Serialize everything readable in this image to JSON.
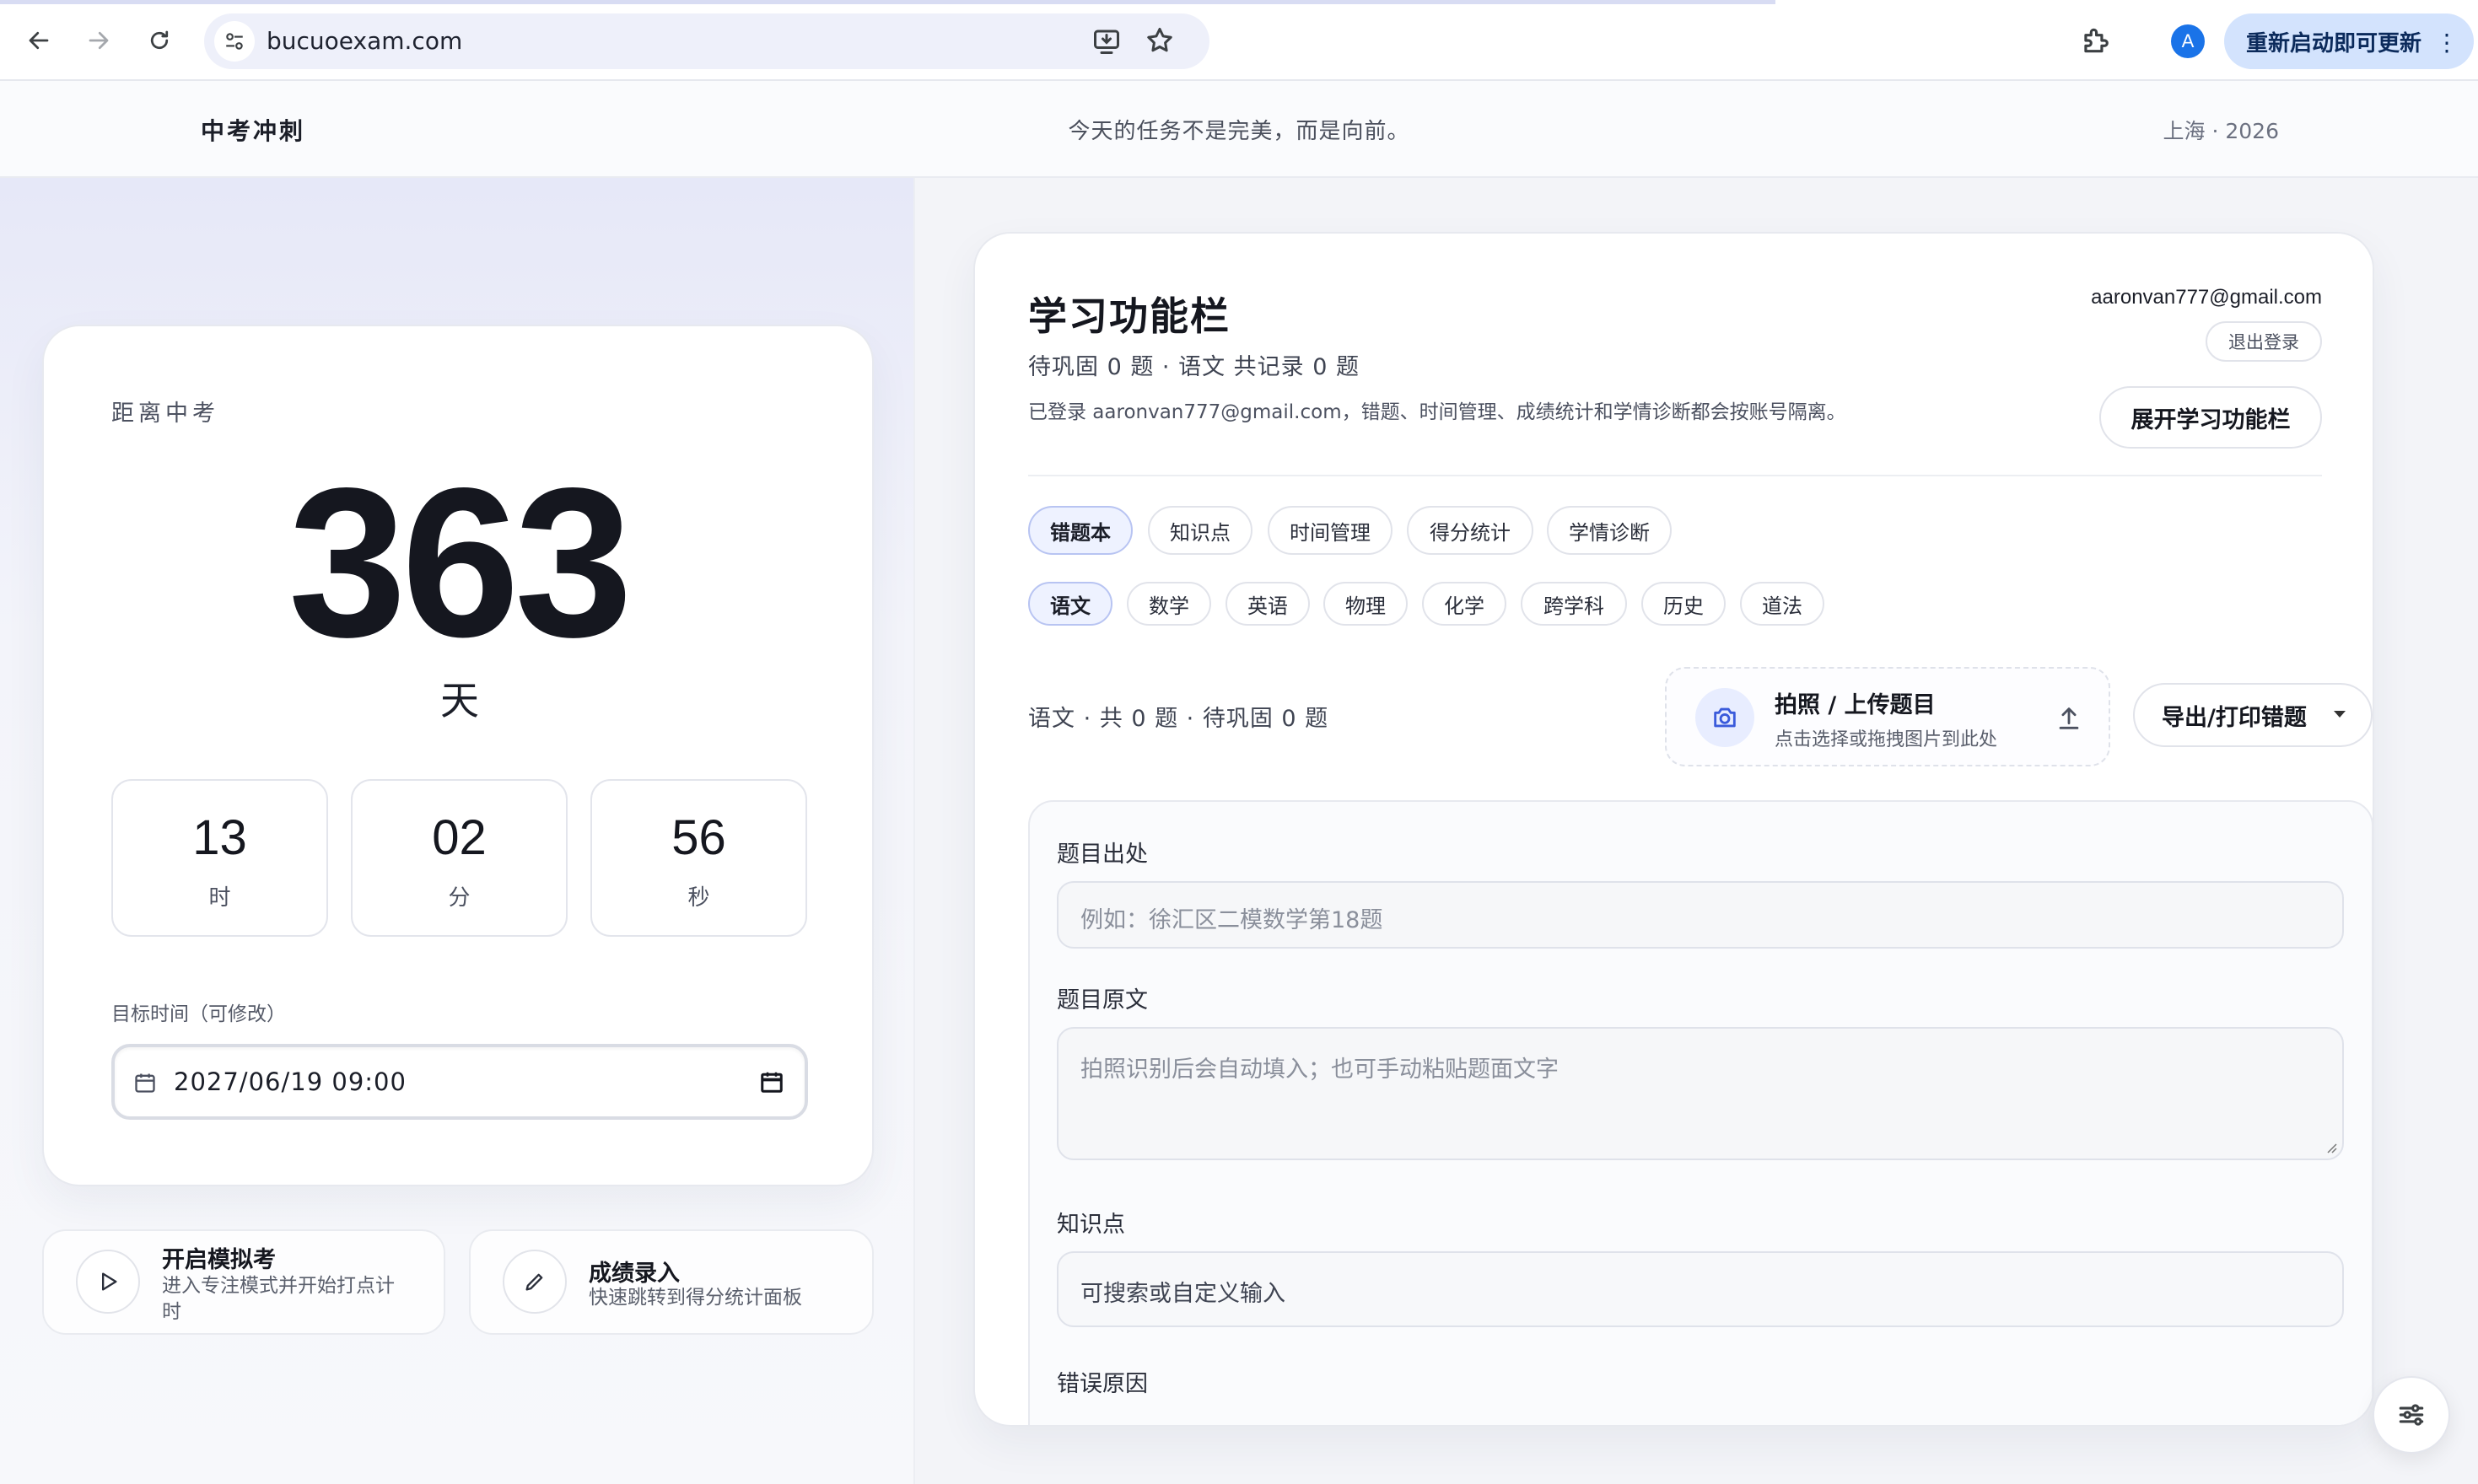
{
  "browser": {
    "url": "bucuoexam.com",
    "update_label": "重新启动即可更新",
    "avatar_letter": "A",
    "kebab": "⋮"
  },
  "header": {
    "brand": "中考冲刺",
    "motto": "今天的任务不是完美，而是向前。",
    "location": "上海 · 2026"
  },
  "countdown": {
    "label": "距离中考",
    "days": "363",
    "days_unit": "天",
    "hours": "13",
    "hours_unit": "时",
    "minutes": "02",
    "minutes_unit": "分",
    "seconds": "56",
    "seconds_unit": "秒",
    "target_label": "目标时间（可修改）",
    "target_value": "2027/06/19  09:00"
  },
  "actions": [
    {
      "title": "开启模拟考",
      "desc_line1": "进入专注模式并开始打点计",
      "desc_line2": "时",
      "icon": "play-icon"
    },
    {
      "title": "成绩录入",
      "desc_line1": "快速跳转到得分统计面板",
      "icon": "pencil-icon"
    }
  ],
  "study": {
    "title": "学习功能栏",
    "summary": "待巩固 0 题 · 语文 共记录 0 题",
    "note": "已登录 aaronvan777@gmail.com，错题、时间管理、成绩统计和学情诊断都会按账号隔离。",
    "email": "aaronvan777@gmail.com",
    "logout": "退出登录",
    "expand": "展开学习功能栏",
    "tabs": [
      "错题本",
      "知识点",
      "时间管理",
      "得分统计",
      "学情诊断"
    ],
    "active_tab": "错题本",
    "subjects": [
      "语文",
      "数学",
      "英语",
      "物理",
      "化学",
      "跨学科",
      "历史",
      "道法"
    ],
    "active_subject": "语文",
    "subject_stats": "语文 · 共 0 题 · 待巩固 0 题",
    "upload_title": "拍照 / 上传题目",
    "upload_hint": "点击选择或拖拽图片到此处",
    "export": "导出/打印错题"
  },
  "form": {
    "source_label": "题目出处",
    "source_placeholder": "例如：徐汇区二模数学第18题",
    "text_label": "题目原文",
    "text_placeholder": "拍照识别后会自动填入；也可手动粘贴题面文字",
    "knowledge_label": "知识点",
    "knowledge_placeholder": "可搜索或自定义输入",
    "cause_label": "错误原因"
  },
  "colors": {
    "accent_blue": "#1a73e8",
    "pill_active_bg": "#eef2ff",
    "update_btn_bg": "#d3e3fd"
  }
}
